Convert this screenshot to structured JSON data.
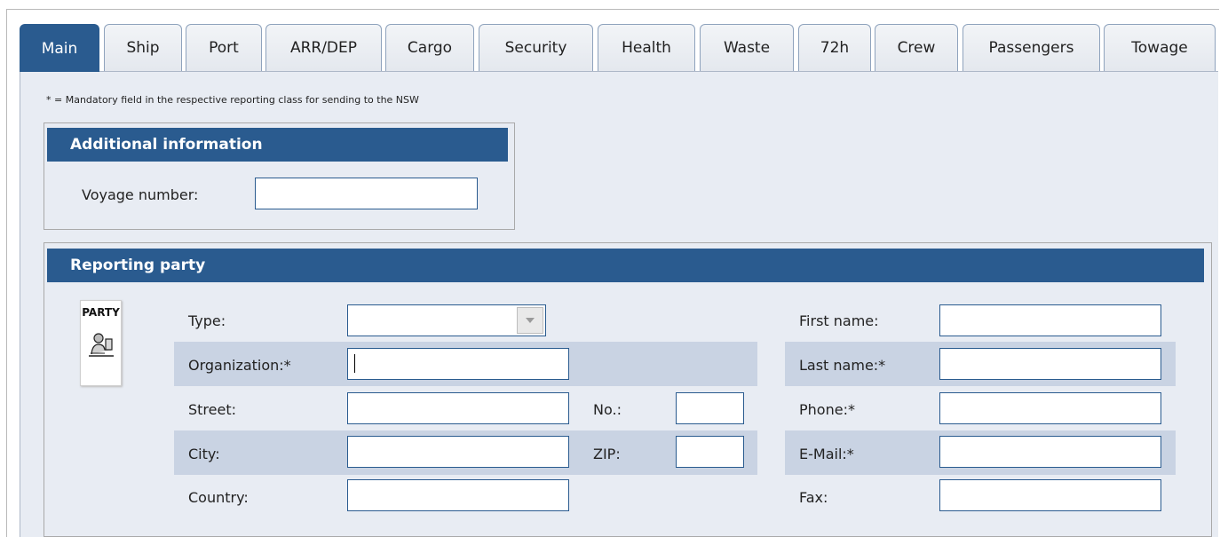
{
  "tabs": [
    "Main",
    "Ship",
    "Port",
    "ARR/DEP",
    "Cargo",
    "Security",
    "Health",
    "Waste",
    "72h",
    "Crew",
    "Passengers",
    "Towage"
  ],
  "active_tab": "Main",
  "note": "* = Mandatory field in the respective reporting class for sending to the NSW",
  "additional": {
    "header": "Additional information",
    "voyage_label": "Voyage number:",
    "voyage_value": ""
  },
  "reporting": {
    "header": "Reporting party",
    "icon_label": "PARTY",
    "type_label": "Type:",
    "type_value": "",
    "organization_label": "Organization:*",
    "organization_value": "",
    "street_label": "Street:",
    "street_value": "",
    "no_label": "No.:",
    "no_value": "",
    "city_label": "City:",
    "city_value": "",
    "zip_label": "ZIP:",
    "zip_value": "",
    "country_label": "Country:",
    "country_value": "",
    "first_name_label": "First name:",
    "first_name_value": "",
    "last_name_label": "Last name:*",
    "last_name_value": "",
    "phone_label": "Phone:*",
    "phone_value": "",
    "email_label": "E-Mail:*",
    "email_value": "",
    "fax_label": "Fax:",
    "fax_value": ""
  },
  "colors": {
    "accent": "#2a5b8f",
    "panel": "#e8ecf3",
    "row_shade": "#c9d3e3"
  },
  "icons": [
    "party-person-icon",
    "chevron-down-icon"
  ]
}
